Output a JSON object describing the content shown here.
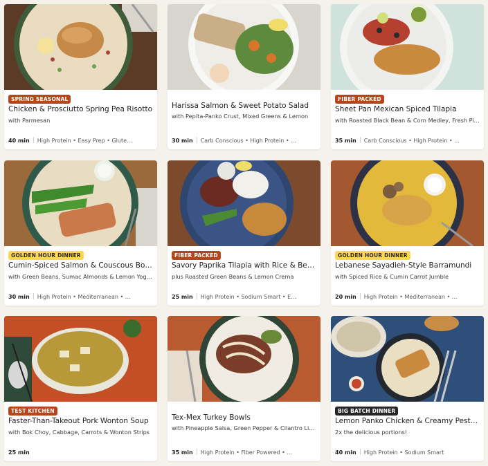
{
  "recipes": [
    {
      "badge": "Spring Seasonal",
      "title": "Chicken & Prosciutto Spring Pea Risotto",
      "subtitle": "with Parmesan",
      "time": "40 min",
      "tags": "High Protein • Easy Prep • Glute..."
    },
    {
      "badge": "",
      "title": "Harissa Salmon & Sweet Potato Salad",
      "subtitle": "with Pepita-Panko Crust, Mixed Greens & Lemon",
      "time": "30 min",
      "tags": "Carb Conscious • High Protein • ..."
    },
    {
      "badge": "Fiber Packed",
      "title": "Sheet Pan Mexican Spiced Tilapia",
      "subtitle": "with Roasted Black Bean & Corn Medley, Fresh Pico ...",
      "time": "35 min",
      "tags": "Carb Conscious • High Protein • ..."
    },
    {
      "badge": "Golden Hour Dinner",
      "title": "Cumin-Spiced Salmon & Couscous Bowls",
      "subtitle": "with Green Beans, Sumac Almonds & Lemon Yogurt ...",
      "time": "30 min",
      "tags": "High Protein • Mediterranean • ..."
    },
    {
      "badge": "Fiber Packed",
      "title": "Savory Paprika Tilapia with Rice & Beans",
      "subtitle": "plus Roasted Green Beans & Lemon Crema",
      "time": "25 min",
      "tags": "High Protein • Sodium Smart • E..."
    },
    {
      "badge": "Golden Hour Dinner",
      "title": "Lebanese Sayadieh-Style Barramundi",
      "subtitle": "with Spiced Rice & Cumin Carrot Jumble",
      "time": "20 min",
      "tags": "High Protein • Mediterranean • ..."
    },
    {
      "badge": "Test Kitchen",
      "title": "Faster-Than-Takeout Pork Wonton Soup",
      "subtitle": "with Bok Choy, Cabbage, Carrots & Wonton Strips",
      "time": "25 min",
      "tags": ""
    },
    {
      "badge": "",
      "title": "Tex-Mex Turkey Bowls",
      "subtitle": "with Pineapple Salsa, Green Pepper & Cilantro Lime...",
      "time": "35 min",
      "tags": "High Protein • Fiber Powered • ..."
    },
    {
      "badge": "Big Batch Dinner",
      "title": "Lemon Panko Chicken & Creamy Pesto ...",
      "subtitle": "2x the delicious portions!",
      "time": "40 min",
      "tags": "High Protein • Sodium Smart"
    }
  ],
  "colors": {
    "badge_red": "#b5451b",
    "badge_yellow": "#ffd84d",
    "badge_black": "#262626",
    "page_bg": "#f5f2ec"
  }
}
